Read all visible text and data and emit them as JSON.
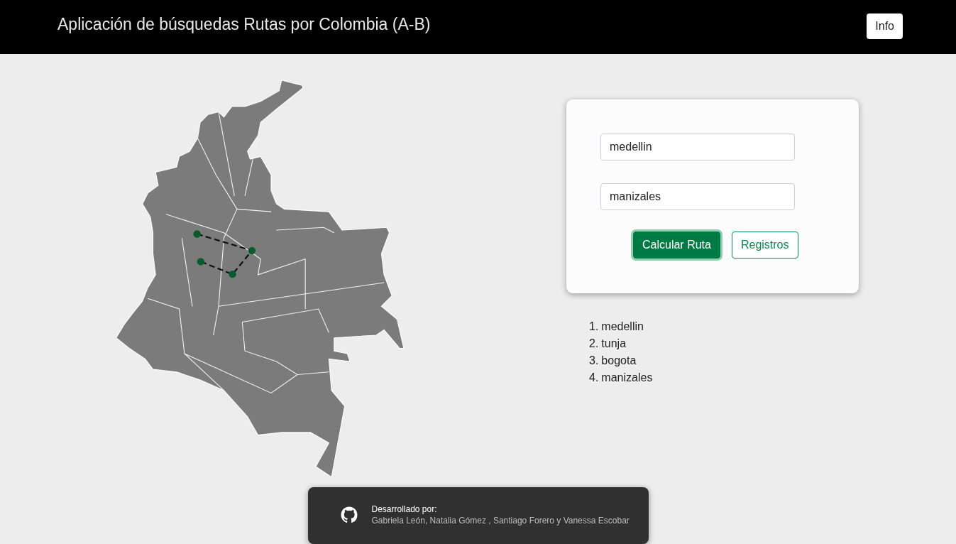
{
  "header": {
    "title": "Aplicación de búsquedas Rutas por Colombia (A-B)",
    "info_button": "Info"
  },
  "form": {
    "origin": {
      "value": "medellin"
    },
    "destination": {
      "value": "manizales"
    },
    "buttons": [
      {
        "label": "Calcular Ruta",
        "kind": "primary"
      },
      {
        "label": "Registros",
        "kind": "outline"
      }
    ]
  },
  "route": [
    {
      "number": "1.",
      "name": "medellin"
    },
    {
      "number": "2.",
      "name": "tunja"
    },
    {
      "number": "3.",
      "name": "bogota"
    },
    {
      "number": "4.",
      "name": "manizales"
    }
  ],
  "footer": {
    "heading": "Desarrollado por:",
    "authors": "Gabriela León, Natalia Gómez , Santiago Forero y Vanessa Escobar"
  }
}
